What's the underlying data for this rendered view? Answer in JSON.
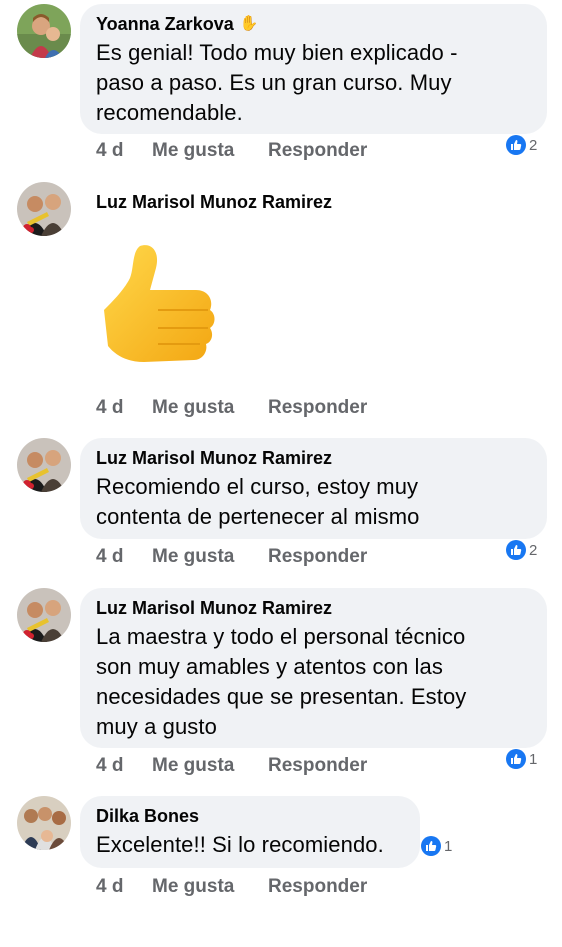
{
  "comments": [
    {
      "author": "Yoanna Zarkova",
      "text_lines": [
        "Es genial!  Todo muy bien explicado -",
        "paso a paso. Es un gran curso. Muy",
        "recomendable."
      ],
      "time": "4 d",
      "like_label": "Me gusta",
      "reply_label": "Responder",
      "reactions": "2"
    },
    {
      "author": "Luz Marisol Munoz Ramirez",
      "sticker": "thumbs-up",
      "time": "4 d",
      "like_label": "Me gusta",
      "reply_label": "Responder"
    },
    {
      "author": "Luz Marisol Munoz Ramirez",
      "text_lines": [
        "Recomiendo el curso, estoy muy",
        "contenta de pertenecer al mismo"
      ],
      "time": "4 d",
      "like_label": "Me gusta",
      "reply_label": "Responder",
      "reactions": "2"
    },
    {
      "author": "Luz Marisol Munoz Ramirez",
      "text_lines": [
        "La maestra y todo el personal técnico",
        "son muy amables y atentos con las",
        "necesidades que se presentan. Estoy",
        "muy a gusto"
      ],
      "time": "4 d",
      "like_label": "Me gusta",
      "reply_label": "Responder",
      "reactions": "1"
    },
    {
      "author": "Dilka Bones",
      "text_lines": [
        "Excelente!! Si lo recomiendo."
      ],
      "time": "4 d",
      "like_label": "Me gusta",
      "reply_label": "Responder",
      "reactions": "1"
    }
  ],
  "colors": {
    "bubble": "#f0f2f5",
    "secondary_text": "#65676b",
    "like_blue": "#1877f2"
  }
}
